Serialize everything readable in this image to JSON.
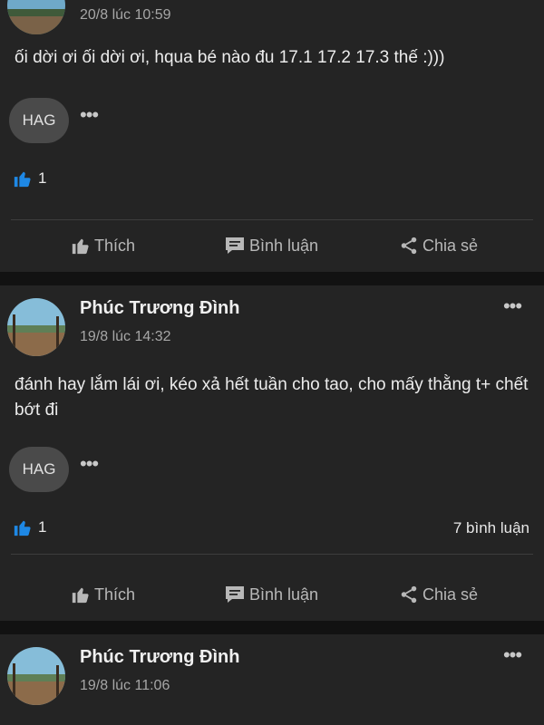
{
  "colors": {
    "background": "#121212",
    "card": "#242424",
    "chip": "#4a4a4a",
    "like_blue": "#1e88e5",
    "muted_text": "#a6a6a6"
  },
  "icons": {
    "like": "thumbs-up-icon",
    "comment": "speech-bubble-icon",
    "share": "share-icon",
    "more": "more-dots-icon"
  },
  "posts": [
    {
      "time": "20/8 lúc 10:59",
      "content": "ối dời ơi ối dời ơi, hqua bé nào đu 17.1 17.2 17.3 thế :)))",
      "chip": "HAG",
      "chip_more": "•••",
      "likes": "1",
      "actions": {
        "like": "Thích",
        "comment": "Bình luận",
        "share": "Chia sẻ"
      }
    },
    {
      "author": "Phúc Trương Đình",
      "time": "19/8 lúc 14:32",
      "more": "•••",
      "content": "đánh hay lắm lái ơi, kéo xả hết tuần cho tao, cho mấy thằng t+ chết bớt đi",
      "chip": "HAG",
      "chip_more": "•••",
      "likes": "1",
      "comments": "7 bình luận",
      "actions": {
        "like": "Thích",
        "comment": "Bình luận",
        "share": "Chia sẻ"
      }
    },
    {
      "author": "Phúc Trương Đình",
      "time": "19/8 lúc 11:06",
      "more": "•••"
    }
  ]
}
